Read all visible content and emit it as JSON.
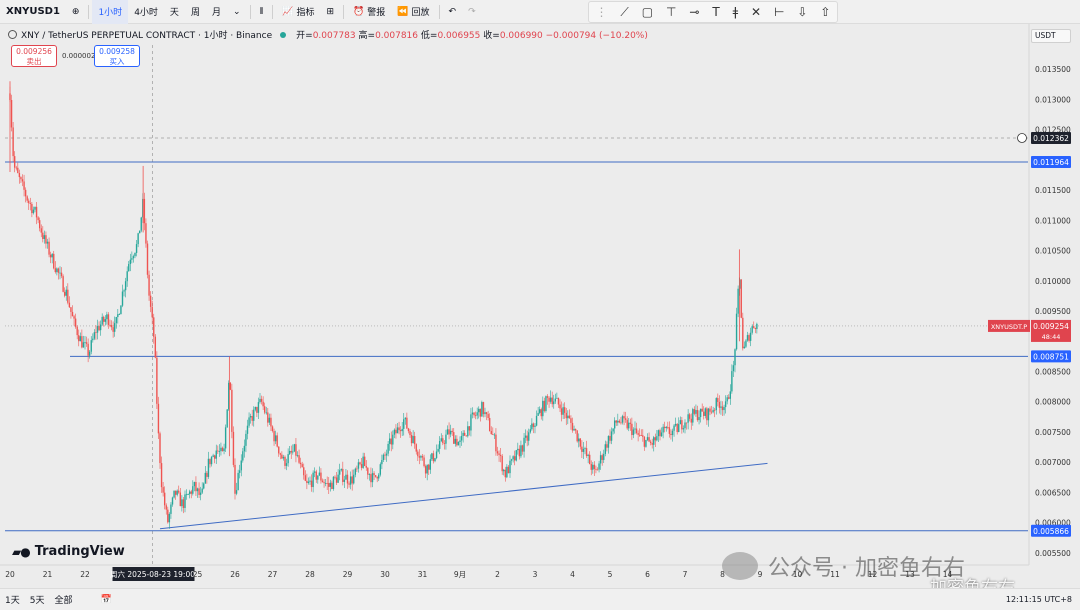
{
  "toolbar": {
    "symbol": "XNYUSD1",
    "add_symbol_icon": "plus-circle-icon",
    "timeframes": [
      "1小时",
      "4小时",
      "天",
      "周",
      "月"
    ],
    "active_timeframe": "1小时",
    "indicators_label": "指标",
    "alert_label": "警报",
    "replay_label": "回放"
  },
  "draw_tools": [
    "trend-line-icon",
    "rectangle-icon",
    "text-box-icon",
    "horizontal-ray-icon",
    "text-icon",
    "price-marker-icon",
    "cross-icon",
    "measure-icon",
    "arrow-down-icon",
    "arrow-up-icon"
  ],
  "legend": {
    "title": "XNY / TetherUS PERPETUAL CONTRACT · 1小时 · Binance",
    "open_label": "开=",
    "open": "0.007783",
    "high_label": "高=",
    "high": "0.007816",
    "low_label": "低=",
    "low": "0.006955",
    "close_label": "收=",
    "close": "0.006990",
    "change": "−0.000794 (−10.20%)"
  },
  "trade": {
    "sell_price": "0.009256",
    "sell_label": "卖出",
    "spread": "0.000002",
    "buy_price": "0.009258",
    "buy_label": "买入"
  },
  "currency": "USDT",
  "branding": {
    "logo": "TradingView"
  },
  "watermark": {
    "text": "公众号 · 加密鱼右右",
    "text2": "加密鱼右右"
  },
  "bottom": {
    "ranges": [
      "1天",
      "5天",
      "全部"
    ],
    "clock": "12:11:15 UTC+8"
  },
  "colors": {
    "up": "#26a69a",
    "down": "#ef5350",
    "line": "#3f6bc4",
    "price_tag": "#e0444e"
  },
  "chart_data": {
    "type": "candlestick",
    "symbol": "XNYUSDT.P",
    "ylim": [
      0.0053,
      0.0139
    ],
    "y_ticks": [
      "0.013500",
      "0.013000",
      "0.012500",
      "0.011500",
      "0.011000",
      "0.010500",
      "0.010000",
      "0.009500",
      "0.008500",
      "0.008000",
      "0.007500",
      "0.007000",
      "0.006500",
      "0.006000",
      "0.005500"
    ],
    "y_tick_values": [
      0.0135,
      0.013,
      0.0125,
      0.0115,
      0.011,
      0.0105,
      0.01,
      0.0095,
      0.0085,
      0.008,
      0.0075,
      0.007,
      0.0065,
      0.006,
      0.0055
    ],
    "x_labels": [
      "20",
      "21",
      "22",
      "周六 2025-08-23  19:00",
      "25",
      "26",
      "27",
      "28",
      "29",
      "30",
      "31",
      "9月",
      "2",
      "3",
      "4",
      "5",
      "6",
      "7",
      "8",
      "9",
      "10",
      "11",
      "12",
      "13",
      "14"
    ],
    "x_label_index": [
      0,
      1,
      2,
      3.8,
      5,
      6,
      7,
      8,
      9,
      10,
      11,
      12,
      13,
      14,
      15,
      16,
      17,
      18,
      19,
      20,
      21,
      22,
      23,
      24,
      25
    ],
    "horizontal_levels": [
      {
        "value": 0.011964,
        "label": "0.011964",
        "kind": "resistance"
      },
      {
        "value": 0.008751,
        "label": "0.008751",
        "kind": "support"
      },
      {
        "value": 0.005866,
        "label": "0.005866",
        "kind": "support"
      }
    ],
    "dashed_level": {
      "value": 0.012362,
      "label": "0.012362"
    },
    "current_price": {
      "value": 0.009254,
      "label": "0.009254",
      "symbol_tag": "XNYUSDT.P",
      "countdown": "48:44"
    },
    "trendline": {
      "from": {
        "day": 4.0,
        "price": 0.0059
      },
      "to": {
        "day": 20.2,
        "price": 0.00698
      }
    },
    "price_path": [
      [
        0.0,
        0.0131
      ],
      [
        0.1,
        0.0119
      ],
      [
        0.3,
        0.0116
      ],
      [
        0.5,
        0.0113
      ],
      [
        0.7,
        0.0111
      ],
      [
        0.9,
        0.0107
      ],
      [
        1.1,
        0.0104
      ],
      [
        1.3,
        0.0101
      ],
      [
        1.5,
        0.0098
      ],
      [
        1.7,
        0.0093
      ],
      [
        1.9,
        0.009
      ],
      [
        2.1,
        0.0088
      ],
      [
        2.3,
        0.0092
      ],
      [
        2.6,
        0.0094
      ],
      [
        2.8,
        0.0092
      ],
      [
        3.0,
        0.0098
      ],
      [
        3.2,
        0.0104
      ],
      [
        3.4,
        0.0106
      ],
      [
        3.55,
        0.0113
      ],
      [
        3.7,
        0.0098
      ],
      [
        3.85,
        0.009
      ],
      [
        3.95,
        0.0075
      ],
      [
        4.05,
        0.0066
      ],
      [
        4.2,
        0.006
      ],
      [
        4.4,
        0.0065
      ],
      [
        4.6,
        0.0063
      ],
      [
        4.9,
        0.0066
      ],
      [
        5.1,
        0.0064
      ],
      [
        5.3,
        0.007
      ],
      [
        5.5,
        0.0072
      ],
      [
        5.7,
        0.0071
      ],
      [
        5.85,
        0.0085
      ],
      [
        6.0,
        0.0065
      ],
      [
        6.2,
        0.0072
      ],
      [
        6.4,
        0.0077
      ],
      [
        6.7,
        0.008
      ],
      [
        7.0,
        0.0075
      ],
      [
        7.3,
        0.007
      ],
      [
        7.6,
        0.0072
      ],
      [
        7.9,
        0.0066
      ],
      [
        8.2,
        0.0068
      ],
      [
        8.5,
        0.0066
      ],
      [
        8.8,
        0.0068
      ],
      [
        9.1,
        0.0067
      ],
      [
        9.4,
        0.007
      ],
      [
        9.7,
        0.0067
      ],
      [
        10.0,
        0.0071
      ],
      [
        10.2,
        0.0074
      ],
      [
        10.5,
        0.0077
      ],
      [
        10.8,
        0.0073
      ],
      [
        11.1,
        0.0069
      ],
      [
        11.4,
        0.0072
      ],
      [
        11.7,
        0.0075
      ],
      [
        12.0,
        0.0073
      ],
      [
        12.3,
        0.0077
      ],
      [
        12.6,
        0.0079
      ],
      [
        12.9,
        0.0074
      ],
      [
        13.2,
        0.0068
      ],
      [
        13.5,
        0.0071
      ],
      [
        13.8,
        0.0074
      ],
      [
        14.1,
        0.0078
      ],
      [
        14.4,
        0.0081
      ],
      [
        14.7,
        0.0079
      ],
      [
        15.0,
        0.0076
      ],
      [
        15.3,
        0.0072
      ],
      [
        15.6,
        0.0068
      ],
      [
        15.9,
        0.0073
      ],
      [
        16.2,
        0.0077
      ],
      [
        16.5,
        0.0076
      ],
      [
        16.8,
        0.0074
      ],
      [
        17.1,
        0.0073
      ],
      [
        17.4,
        0.0075
      ],
      [
        17.7,
        0.0075
      ],
      [
        18.0,
        0.0077
      ],
      [
        18.3,
        0.0078
      ],
      [
        18.6,
        0.0078
      ],
      [
        18.9,
        0.008
      ],
      [
        19.1,
        0.0079
      ],
      [
        19.3,
        0.0086
      ],
      [
        19.45,
        0.0101
      ],
      [
        19.55,
        0.0088
      ],
      [
        19.7,
        0.0091
      ],
      [
        19.85,
        0.0093
      ],
      [
        19.95,
        0.00925
      ]
    ]
  }
}
